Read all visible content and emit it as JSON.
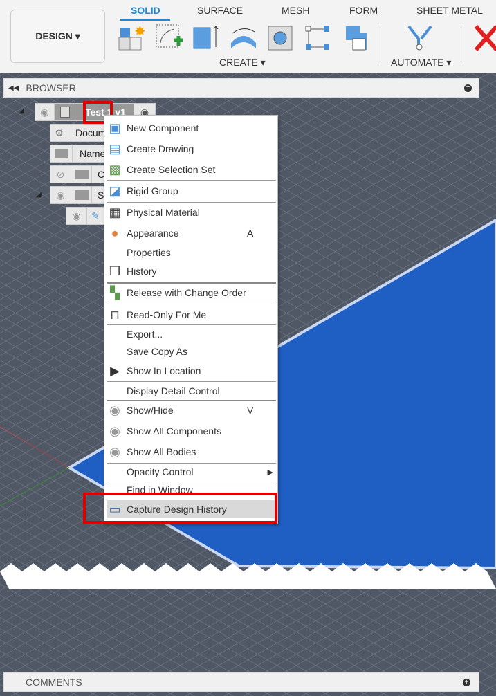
{
  "toolbar": {
    "design_label": "DESIGN ▾",
    "tabs": [
      "SOLID",
      "SURFACE",
      "MESH",
      "FORM",
      "SHEET METAL"
    ],
    "create_label": "CREATE ▾",
    "automate_label": "AUTOMATE ▾"
  },
  "browser": {
    "title": "BROWSER",
    "root": "Test 1 v1",
    "nodes": [
      "Docum",
      "Name",
      "C",
      "S"
    ]
  },
  "menu": {
    "items": [
      {
        "label": "New Component",
        "icon": "new-component-icon"
      },
      {
        "label": "Create Drawing",
        "icon": "create-drawing-icon"
      },
      {
        "label": "Create Selection Set",
        "icon": "selection-set-icon"
      },
      {
        "label": "Rigid Group",
        "icon": "rigid-group-icon"
      },
      {
        "label": "Physical Material",
        "icon": "material-icon"
      },
      {
        "label": "Appearance",
        "icon": "appearance-icon",
        "shortcut": "A"
      },
      {
        "label": "Properties"
      },
      {
        "label": "History",
        "icon": "history-icon"
      },
      {
        "label": "Release with Change Order",
        "icon": "release-icon"
      },
      {
        "label": "Read-Only For Me",
        "icon": "unlock-icon"
      },
      {
        "label": "Export..."
      },
      {
        "label": "Save Copy As"
      },
      {
        "label": "Show In Location",
        "icon": "show-location-icon"
      },
      {
        "label": "Display Detail Control"
      },
      {
        "label": "Show/Hide",
        "icon": "eye-icon",
        "shortcut": "V"
      },
      {
        "label": "Show All Components",
        "icon": "eye-icon"
      },
      {
        "label": "Show All Bodies",
        "icon": "eye-icon"
      },
      {
        "label": "Opacity Control",
        "submenu": true
      },
      {
        "label": "Find in Window"
      },
      {
        "label": "Capture Design History",
        "icon": "capture-history-icon"
      }
    ]
  },
  "comments": {
    "title": "COMMENTS"
  }
}
